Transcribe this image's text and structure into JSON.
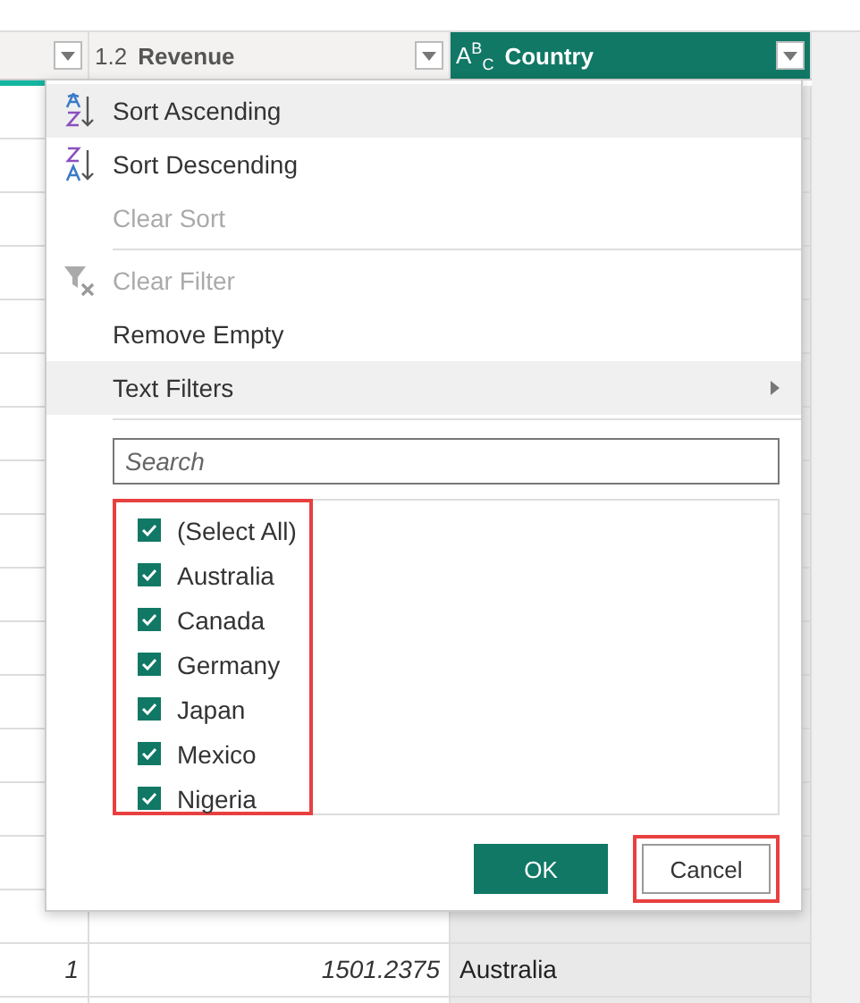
{
  "columns": [
    {
      "type_label": "1.2",
      "name": "Revenue",
      "selected": false
    },
    {
      "type_label": "A$^{B}$$_{C}$",
      "name": "Country",
      "selected": true
    }
  ],
  "rows": [
    {
      "cells": [
        "1",
        "1501.2375",
        "Australia"
      ]
    }
  ],
  "menu": {
    "items": [
      {
        "kind": "sort-asc",
        "label": "Sort Ascending",
        "disabled": false,
        "highlighted": true
      },
      {
        "kind": "sort-desc",
        "label": "Sort Descending",
        "disabled": false,
        "highlighted": false
      },
      {
        "kind": "plain",
        "label": "Clear Sort",
        "disabled": true,
        "highlighted": false
      },
      {
        "kind": "separator"
      },
      {
        "kind": "clear-filter",
        "label": "Clear Filter",
        "disabled": true,
        "highlighted": false
      },
      {
        "kind": "plain",
        "label": "Remove Empty",
        "disabled": false,
        "highlighted": false
      },
      {
        "kind": "submenu",
        "label": "Text Filters",
        "disabled": false,
        "highlighted": true
      },
      {
        "kind": "separator"
      }
    ],
    "search": {
      "placeholder": "Search"
    },
    "values": [
      {
        "label": "(Select All)",
        "checked": true
      },
      {
        "label": "Australia",
        "checked": true
      },
      {
        "label": "Canada",
        "checked": true
      },
      {
        "label": "Germany",
        "checked": true
      },
      {
        "label": "Japan",
        "checked": true
      },
      {
        "label": "Mexico",
        "checked": true
      },
      {
        "label": "Nigeria",
        "checked": true
      }
    ],
    "values_highlighted": true,
    "buttons": [
      {
        "label": "OK",
        "kind": "primary",
        "highlighted": false
      },
      {
        "label": "Cancel",
        "kind": "secondary",
        "highlighted": true
      }
    ]
  }
}
